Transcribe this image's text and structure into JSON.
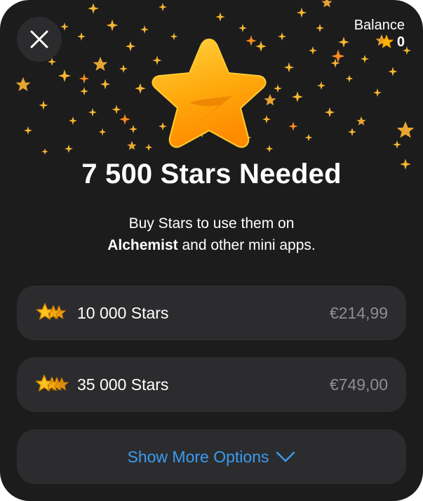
{
  "header": {
    "balance_label": "Balance",
    "balance_value": "0",
    "close_icon": "close-icon"
  },
  "hero": {
    "title": "7 500 Stars Needed",
    "subtitle_line1": "Buy Stars to use them on",
    "subtitle_bold": "Alchemist",
    "subtitle_line2_rest": " and other mini apps."
  },
  "options": [
    {
      "label": "10 000 Stars",
      "price": "€214,99",
      "icon": "stars-stack-icon"
    },
    {
      "label": "35 000 Stars",
      "price": "€749,00",
      "icon": "stars-stack-icon"
    }
  ],
  "more": {
    "label": "Show More Options",
    "icon": "chevron-down-icon"
  },
  "colors": {
    "sheet_bg": "#1c1c1d",
    "card_bg": "#2c2c2e",
    "star_gold": "#ffb20a",
    "accent_blue": "#3a9bf2",
    "price_gray": "#8e8e93"
  }
}
